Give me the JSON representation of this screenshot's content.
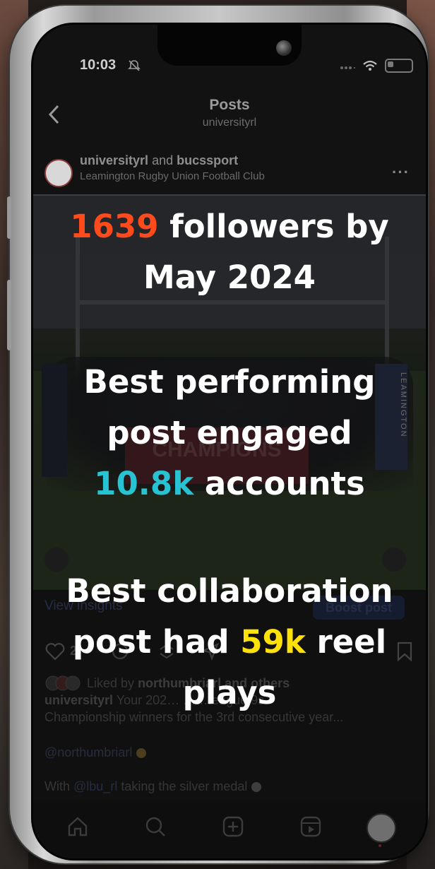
{
  "status_bar": {
    "time": "10:03"
  },
  "header": {
    "title": "Posts",
    "subtitle": "universityrl"
  },
  "post": {
    "author_primary": "universityrl",
    "author_connector": "and",
    "author_secondary": "bucssport",
    "location": "Leamington Rugby Union Football Club",
    "banner_text": "CHAMPIONS",
    "flag_text": "LEAMINGTON",
    "view_insights": "View insights",
    "boost_post": "Boost post",
    "like_count": "2",
    "liked_by_prefix": "Liked by",
    "liked_by_user": "northumbriarl",
    "liked_by_suffix": "and others",
    "caption_user": "universityrl",
    "caption_line1": "Your 202… … …eague 9s",
    "caption_line2": "Championship winners for the 3rd consecutive year...",
    "mention": "@northumbriarl",
    "silver_prefix": "With",
    "silver_tag": "@lbu_rl",
    "silver_suffix": "taking the silver medal"
  },
  "overlay_stats": {
    "followers_number": "1639",
    "followers_text_a": "followers by",
    "followers_text_b": "May 2024",
    "best_post_a": "Best performing",
    "best_post_b": "post engaged",
    "best_post_number": "10.8k",
    "best_post_c": "accounts",
    "collab_a": "Best collaboration",
    "collab_b": "post had",
    "collab_number": "59k",
    "collab_c": "reel",
    "collab_d": "plays"
  },
  "colors": {
    "highlight_orange": "#ff4a1c",
    "highlight_cyan": "#27c3d2",
    "highlight_yellow": "#ffe10a"
  },
  "icons": [
    "bell-slash-icon",
    "signal-icon",
    "wifi-icon",
    "battery-icon",
    "back-arrow-icon",
    "more-icon",
    "user-tag-icon",
    "speaker-icon",
    "heart-icon",
    "comment-icon",
    "repost-icon",
    "share-icon",
    "bookmark-icon",
    "home-icon",
    "search-icon",
    "create-icon",
    "reels-icon",
    "profile-icon"
  ]
}
